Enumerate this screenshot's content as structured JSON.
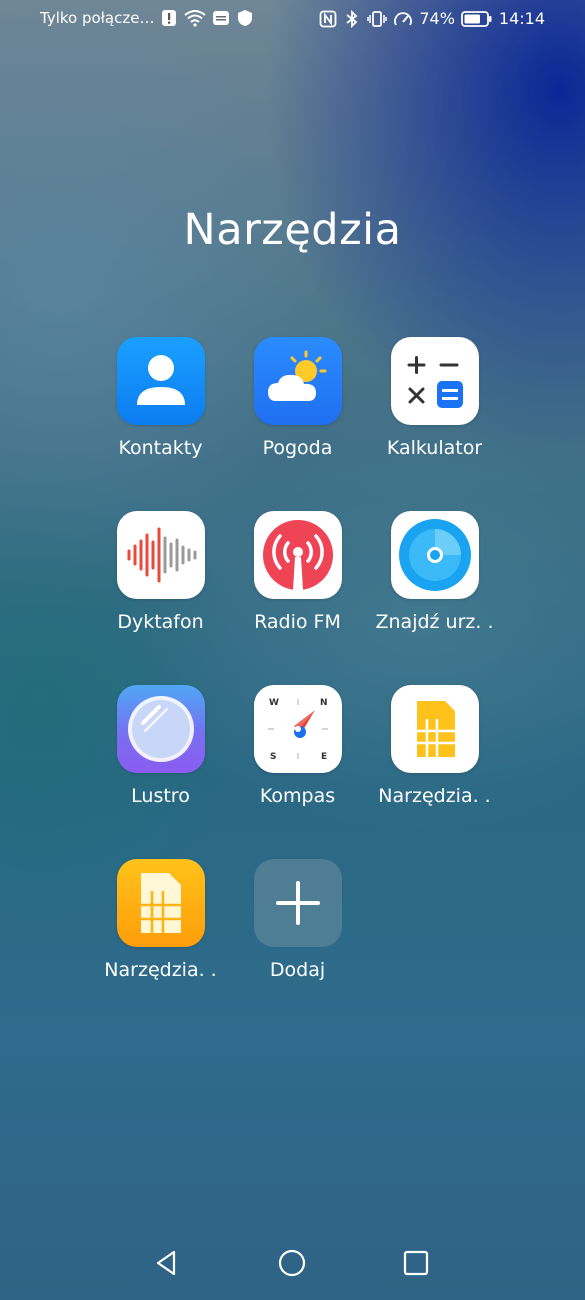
{
  "status_bar": {
    "carrier": "Tylko połącze…",
    "icons_left": [
      "alert-icon",
      "wifi-icon",
      "message-icon",
      "shield-icon"
    ],
    "icons_right": [
      "nfc-icon",
      "bluetooth-icon",
      "vibrate-icon",
      "speed-icon"
    ],
    "battery_percent": "74%",
    "battery_level": 0.74,
    "time": "14:14"
  },
  "folder": {
    "title": "Narzędzia",
    "apps": [
      {
        "label": "Kontakty",
        "icon": "contacts-icon"
      },
      {
        "label": "Pogoda",
        "icon": "weather-icon"
      },
      {
        "label": "Kalkulator",
        "icon": "calculator-icon"
      },
      {
        "label": "Dyktafon",
        "icon": "voice-recorder-icon"
      },
      {
        "label": "Radio FM",
        "icon": "radio-icon"
      },
      {
        "label": "Znajdź urz. .",
        "icon": "find-device-icon"
      },
      {
        "label": "Lustro",
        "icon": "mirror-icon"
      },
      {
        "label": "Kompas",
        "icon": "compass-icon"
      },
      {
        "label": "Narzędzia. .",
        "icon": "sim-toolkit-icon"
      },
      {
        "label": "Narzędzia. .",
        "icon": "sim-toolkit-icon"
      },
      {
        "label": "Dodaj",
        "icon": "add-icon"
      }
    ]
  },
  "nav": {
    "back_icon": "back-icon",
    "home_icon": "home-icon",
    "recents_icon": "recents-icon"
  }
}
